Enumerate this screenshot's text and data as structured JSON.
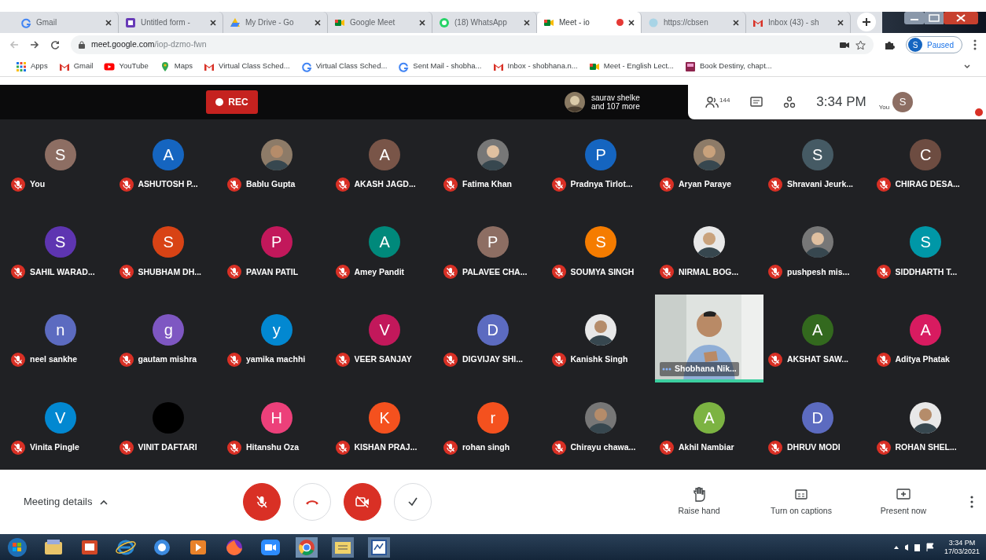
{
  "browser": {
    "tabs": [
      {
        "title": "Gmail",
        "kind": "google",
        "selected": false,
        "recording": false
      },
      {
        "title": "Untitled form -",
        "kind": "forms",
        "selected": false,
        "recording": false
      },
      {
        "title": "My Drive - Go",
        "kind": "drive",
        "selected": false,
        "recording": false
      },
      {
        "title": "Google Meet",
        "kind": "meet",
        "selected": false,
        "recording": false
      },
      {
        "title": "(18) WhatsApp",
        "kind": "whatsapp",
        "selected": false,
        "recording": false
      },
      {
        "title": "Meet - io",
        "kind": "meet",
        "selected": true,
        "recording": true
      },
      {
        "title": "https://cbsen",
        "kind": "page",
        "selected": false,
        "recording": false
      },
      {
        "title": "Inbox (43) - sh",
        "kind": "gmail",
        "selected": false,
        "recording": false
      }
    ],
    "address": {
      "host": "meet.google.com",
      "path": "/iop-dzmo-fwn"
    },
    "profile": {
      "initial": "S",
      "status": "Paused"
    },
    "bookmarks": [
      {
        "label": "Apps",
        "kind": "apps"
      },
      {
        "label": "Gmail",
        "kind": "gmail"
      },
      {
        "label": "YouTube",
        "kind": "youtube"
      },
      {
        "label": "Maps",
        "kind": "maps"
      },
      {
        "label": "Virtual Class Sched...",
        "kind": "gmail"
      },
      {
        "label": "Virtual Class Sched...",
        "kind": "google"
      },
      {
        "label": "Sent Mail - shobha...",
        "kind": "google"
      },
      {
        "label": "Inbox - shobhana.n...",
        "kind": "gmail"
      },
      {
        "label": "Meet - English Lect...",
        "kind": "meet"
      },
      {
        "label": "Book Destiny, chapt...",
        "kind": "book"
      }
    ]
  },
  "meet": {
    "rec": "REC",
    "presenter": {
      "name": "saurav shelke",
      "more": "and 107 more"
    },
    "people_count": "144",
    "time": "3:34 PM",
    "self_label": "You",
    "self_initial": "S",
    "participants": [
      {
        "name": "You",
        "kind": "letter",
        "letter": "S",
        "color": "#8d6e63",
        "muted": true
      },
      {
        "name": "ASHUTOSH P...",
        "kind": "letter",
        "letter": "A",
        "color": "#1565c0",
        "muted": true
      },
      {
        "name": "Bablu Gupta",
        "muted": true
      },
      {
        "name": "AKASH JAGD...",
        "kind": "letter",
        "letter": "A",
        "color": "#795548",
        "muted": true
      },
      {
        "name": "Fatima Khan",
        "muted": true
      },
      {
        "name": "Pradnya Tirlot...",
        "kind": "letter",
        "letter": "P",
        "color": "#1565c0",
        "muted": true
      },
      {
        "name": "Aryan Paraye",
        "muted": true
      },
      {
        "name": "Shravani Jeurk...",
        "kind": "letter",
        "letter": "S",
        "color": "#455a64",
        "muted": true
      },
      {
        "name": "CHIRAG DESA...",
        "kind": "letter",
        "letter": "C",
        "color": "#6d4c41",
        "muted": true
      },
      {
        "name": "SAHIL WARAD...",
        "kind": "letter",
        "letter": "S",
        "color": "#5e35b1",
        "muted": true
      },
      {
        "name": "SHUBHAM DH...",
        "kind": "letter",
        "letter": "S",
        "color": "#d84315",
        "muted": true
      },
      {
        "name": "PAVAN PATIL",
        "kind": "letter",
        "letter": "P",
        "color": "#c2185b",
        "muted": true
      },
      {
        "name": "Amey Pandit",
        "kind": "letter",
        "letter": "A",
        "color": "#00897b",
        "muted": true
      },
      {
        "name": "PALAVEE CHA...",
        "kind": "letter",
        "letter": "P",
        "color": "#8d6e63",
        "muted": true
      },
      {
        "name": "SOUMYA SINGH",
        "kind": "letter",
        "letter": "S",
        "color": "#f57c00",
        "muted": true
      },
      {
        "name": "NIRMAL BOG...",
        "muted": true
      },
      {
        "name": "pushpesh mis...",
        "muted": true
      },
      {
        "name": "SIDDHARTH T...",
        "kind": "letter",
        "letter": "S",
        "color": "#0097a7",
        "muted": true
      },
      {
        "name": "neel sankhe",
        "kind": "letter",
        "letter": "n",
        "color": "#5c6bc0",
        "muted": true
      },
      {
        "name": "gautam mishra",
        "kind": "letter",
        "letter": "g",
        "color": "#7e57c2",
        "muted": true
      },
      {
        "name": "yamika machhi",
        "kind": "letter",
        "letter": "y",
        "color": "#0288d1",
        "muted": true
      },
      {
        "name": "VEER SANJAY",
        "kind": "letter",
        "letter": "V",
        "color": "#c2185b",
        "muted": true
      },
      {
        "name": "DIGVIJAY SHI...",
        "kind": "letter",
        "letter": "D",
        "color": "#5c6bc0",
        "muted": true
      },
      {
        "name": "Kanishk Singh",
        "muted": true
      },
      {
        "name": "Shobhana Nik...",
        "kind": "video",
        "muted": false
      },
      {
        "name": "AKSHAT SAW...",
        "kind": "letter",
        "letter": "A",
        "color": "#33691e",
        "muted": true
      },
      {
        "name": "Aditya Phatak",
        "kind": "letter",
        "letter": "A",
        "color": "#d81b60",
        "muted": true
      },
      {
        "name": "Vinita Pingle",
        "kind": "letter",
        "letter": "V",
        "color": "#0288d1",
        "muted": true
      },
      {
        "name": "VINIT DAFTARI",
        "kind": "letter",
        "color": "#000000",
        "muted": true
      },
      {
        "name": "Hitanshu Oza",
        "kind": "letter",
        "letter": "H",
        "color": "#ec407a",
        "muted": true
      },
      {
        "name": "KISHAN PRAJ...",
        "kind": "letter",
        "letter": "K",
        "color": "#f4511e",
        "muted": true
      },
      {
        "name": "rohan singh",
        "kind": "letter",
        "letter": "r",
        "color": "#f4511e",
        "muted": true
      },
      {
        "name": "Chirayu chawa...",
        "muted": true
      },
      {
        "name": "Akhil Nambiar",
        "kind": "letter",
        "letter": "A",
        "color": "#7cb342",
        "muted": true
      },
      {
        "name": "DHRUV MODI",
        "kind": "letter",
        "letter": "D",
        "color": "#5c6bc0",
        "muted": true
      },
      {
        "name": "ROHAN SHEL...",
        "muted": true
      }
    ],
    "meeting_details": "Meeting details",
    "actions": [
      "Raise hand",
      "Turn on captions",
      "Present now"
    ]
  },
  "taskbar": {
    "time": "3:34 PM",
    "date": "17/03/2021"
  }
}
